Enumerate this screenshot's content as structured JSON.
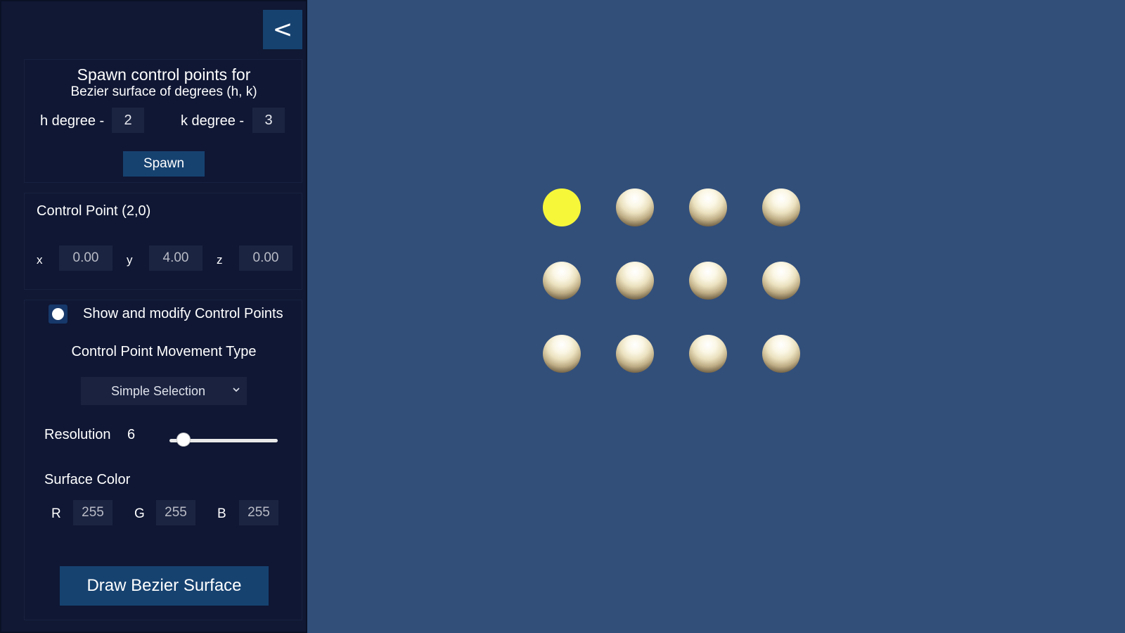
{
  "panel": {
    "collapse_label": "<",
    "spawn": {
      "title": "Spawn control points for",
      "subtitle": "Bezier surface of degrees (h, k)",
      "h_label": "h degree -",
      "h_value": "2",
      "k_label": "k degree -",
      "k_value": "3",
      "button_label": "Spawn"
    },
    "control_point": {
      "title": "Control Point (2,0)",
      "x_label": "x",
      "x_value": "0.00",
      "y_label": "y",
      "y_value": "4.00",
      "z_label": "z",
      "z_value": "0.00"
    },
    "settings": {
      "toggle_label": "Show and modify Control Points",
      "toggle_on": true,
      "movement_title": "Control Point Movement Type",
      "movement_selected": "Simple Selection",
      "resolution_label": "Resolution",
      "resolution_value": "6",
      "resolution_fraction": 0.13,
      "color_title": "Surface Color",
      "r_label": "R",
      "r_value": "255",
      "g_label": "G",
      "g_value": "255",
      "b_label": "B",
      "b_value": "255",
      "draw_button_label": "Draw Bezier Surface"
    }
  },
  "viewport": {
    "background": "#324f7a",
    "control_points": {
      "rows": 3,
      "cols": 4,
      "selected": [
        0,
        0
      ],
      "selected_color": "#f7f73a",
      "sphere_color": "#f3ecd0"
    }
  }
}
